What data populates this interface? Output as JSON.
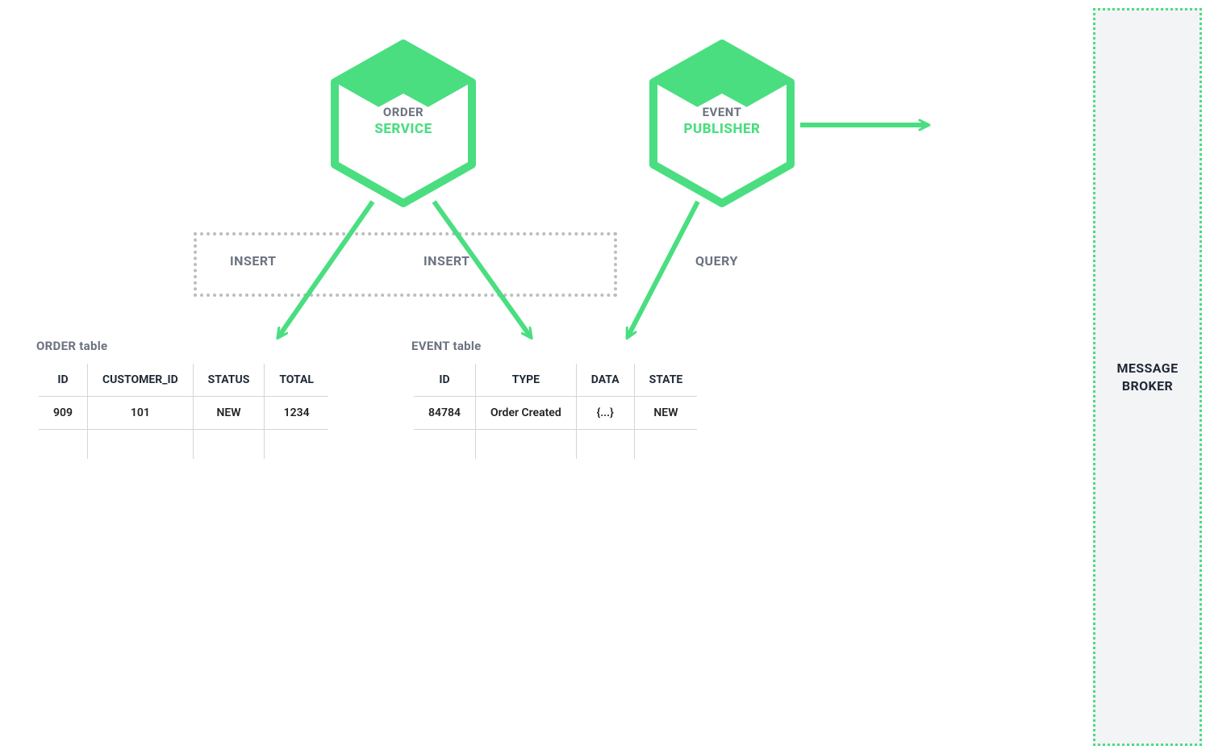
{
  "services": {
    "order": {
      "line1": "ORDER",
      "line2": "SERVICE"
    },
    "publisher": {
      "line1": "EVENT",
      "line2": "PUBLISHER"
    }
  },
  "labels": {
    "insert1": "INSERT",
    "insert2": "INSERT",
    "query": "QUERY"
  },
  "broker": {
    "line1": "MESSAGE",
    "line2": "BROKER"
  },
  "order_table": {
    "title": "ORDER table",
    "headers": [
      "ID",
      "CUSTOMER_ID",
      "STATUS",
      "TOTAL"
    ],
    "rows": [
      [
        "909",
        "101",
        "NEW",
        "1234"
      ]
    ]
  },
  "event_table": {
    "title": "EVENT table",
    "headers": [
      "ID",
      "TYPE",
      "DATA",
      "STATE"
    ],
    "rows": [
      [
        "84784",
        "Order Created",
        "{...}",
        "NEW"
      ]
    ]
  },
  "colors": {
    "green": "#4ade80",
    "grayText": "#6b7280",
    "border": "#d1d5db"
  }
}
